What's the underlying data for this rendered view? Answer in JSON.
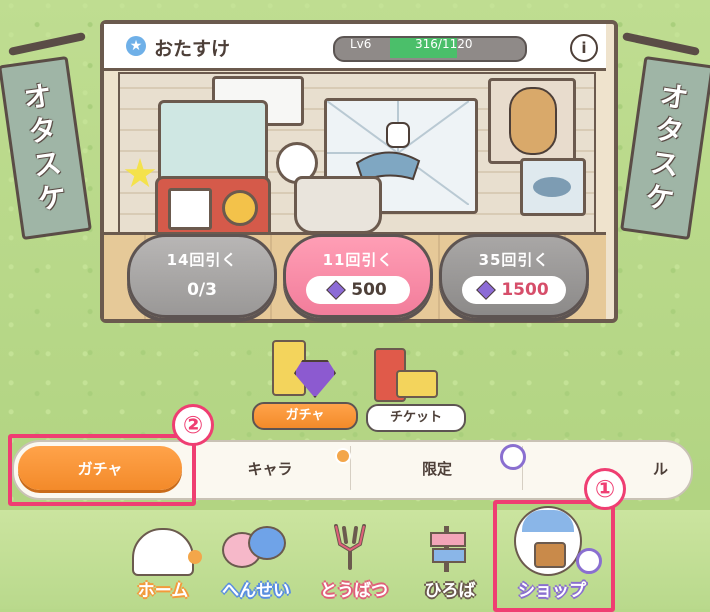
{
  "header": {
    "title": "おたすけ",
    "level_label": "Lv6",
    "progress_text": "316/1120",
    "progress_fraction": 0.28,
    "info_symbol": "i"
  },
  "banners": {
    "left_text": [
      "オ",
      "タ",
      "ス",
      "ケ"
    ],
    "right_text": [
      "オ",
      "タ",
      "ス",
      "ケ"
    ]
  },
  "gacha_buttons": [
    {
      "label": "14回引く",
      "value": "0/3",
      "style": "gray"
    },
    {
      "label": "11回引く",
      "value": "500",
      "style": "pink"
    },
    {
      "label": "35回引く",
      "value": "1500",
      "style": "dark"
    }
  ],
  "categories": [
    {
      "label": "ガチャ",
      "active": true
    },
    {
      "label": "チケット",
      "active": false
    }
  ],
  "tabs": [
    {
      "label": "ガチャ",
      "active": true
    },
    {
      "label": "キャラ",
      "active": false
    },
    {
      "label": "限定",
      "active": false
    },
    {
      "label": "ル",
      "active": false
    }
  ],
  "callouts": [
    "②",
    "①"
  ],
  "bottom_nav": [
    {
      "label": "ホーム",
      "color": "#f39a3c"
    },
    {
      "label": "へんせい",
      "color": "#5a8ee0"
    },
    {
      "label": "とうばつ",
      "color": "#e0607a"
    },
    {
      "label": "ひろば",
      "color": "#6b5a4e"
    },
    {
      "label": "ショップ",
      "color": "#8a6fd0"
    }
  ],
  "colors": {
    "accent": "#ef3e72",
    "active_tab": "#f38a2a",
    "grass": "#b7d88a"
  }
}
